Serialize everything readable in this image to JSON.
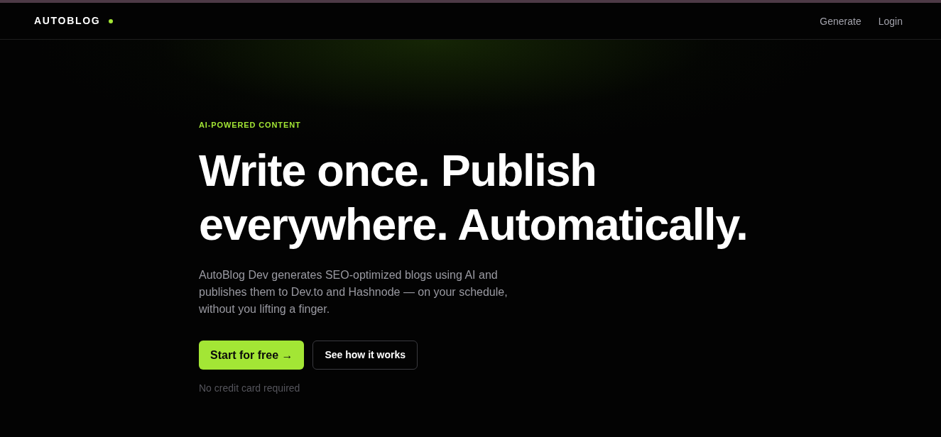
{
  "nav": {
    "logo": "AUTOBLOG",
    "links": [
      {
        "label": "Generate"
      },
      {
        "label": "Login"
      }
    ]
  },
  "hero": {
    "eyebrow": "AI-POWERED CONTENT",
    "headline": "Write once. Publish everywhere. Automatically.",
    "description": "AutoBlog Dev generates SEO-optimized blogs using AI and publishes them to Dev.to and Hashnode — on your schedule, without you lifting a finger.",
    "buttons": [
      {
        "label": "Start for free →",
        "kind": "primary"
      },
      {
        "label": "See how it works",
        "kind": "secondary"
      }
    ],
    "note": "No credit card required"
  }
}
